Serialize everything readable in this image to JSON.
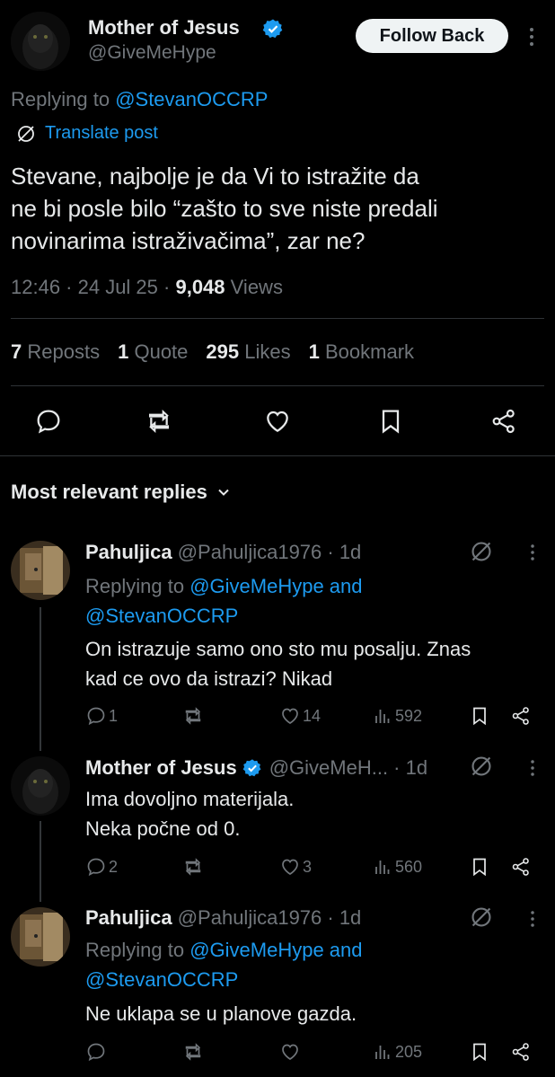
{
  "post": {
    "author_name": "Mother of Jesus",
    "author_handle": "@GiveMeHype",
    "follow_label": "Follow Back",
    "replying_prefix": "Replying to ",
    "replying_to": "@StevanOCCRP",
    "translate_label": "Translate post",
    "text_line1": "Stevane, najbolje je da Vi to istražite da",
    "text_line2": "ne bi posle bilo “zašto to sve niste predali",
    "text_line3": "novinarima istraživačima”, zar ne?",
    "time": "12:46 · 24 Jul 25 ·",
    "views_count": "9,048",
    "views_label": "Views",
    "reposts_count": "7",
    "reposts_label": "Reposts",
    "quotes_count": "1",
    "quotes_label": "Quote",
    "likes_count": "295",
    "likes_label": "Likes",
    "bookmarks_count": "1",
    "bookmarks_label": "Bookmark"
  },
  "replies_header": "Most relevant replies",
  "replies": [
    {
      "name": "Pahuljica",
      "handle_time": "@Pahuljica1976 · 1d",
      "replying_prefix": "Replying to ",
      "replying_line1": "@GiveMeHype and",
      "replying_line2": "@StevanOCCRP",
      "text_line1": "On istrazuje samo ono sto mu posalju. Znas",
      "text_line2": "kad ce ovo da istrazi? Nikad",
      "replies": "1",
      "reposts": "",
      "likes": "14",
      "views": "592"
    },
    {
      "name": "Mother of Jesus",
      "handle_time": "@GiveMeH... · 1d",
      "text_line1": "Ima dovoljno materijala.",
      "text_line2": "Neka počne od 0.",
      "replies": "2",
      "reposts": "",
      "likes": "3",
      "views": "560"
    },
    {
      "name": "Pahuljica",
      "handle_time": "@Pahuljica1976 · 1d",
      "replying_prefix": "Replying to ",
      "replying_line1": "@GiveMeHype and",
      "replying_line2": "@StevanOCCRP",
      "text_line1": "Ne uklapa se u planove gazda.",
      "replies": "",
      "reposts": "",
      "likes": "",
      "views": "205"
    }
  ],
  "colors": {
    "accent": "#1d9bf0",
    "muted": "#71767b",
    "text": "#e7e9ea",
    "background": "#000000"
  }
}
